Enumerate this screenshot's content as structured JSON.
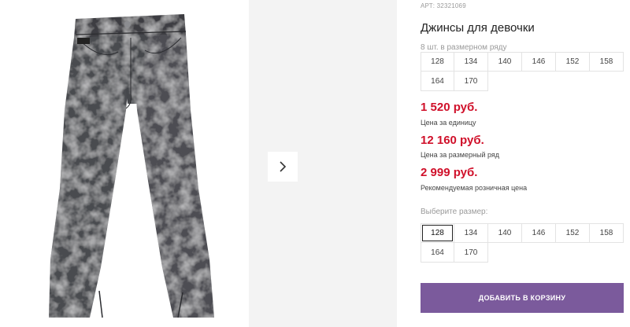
{
  "product": {
    "article": "АРТ: 32321069",
    "title": "Джинсы для девочки",
    "image_alt": "jeans-image"
  },
  "pack": {
    "note": "8 шт. в размерном ряду",
    "sizes": [
      "128",
      "134",
      "140",
      "146",
      "152",
      "158",
      "164",
      "170"
    ]
  },
  "prices": {
    "unit_price": "1 520 руб.",
    "unit_label": "Цена за единицу",
    "pack_price": "12 160 руб.",
    "pack_label": "Цена за размерный ряд",
    "retail_price": "2 999 руб.",
    "retail_label": "Рекомендуемая розничная цена"
  },
  "size_select": {
    "label": "Выберите размер:",
    "sizes": [
      "128",
      "134",
      "140",
      "146",
      "152",
      "158",
      "164",
      "170"
    ],
    "selected": "128"
  },
  "actions": {
    "add_to_cart": "ДОБАВИТЬ В КОРЗИНУ"
  },
  "colors": {
    "price": "#d0102a",
    "button": "#7b5a9c"
  },
  "icons": {
    "next": "chevron-right-icon"
  }
}
